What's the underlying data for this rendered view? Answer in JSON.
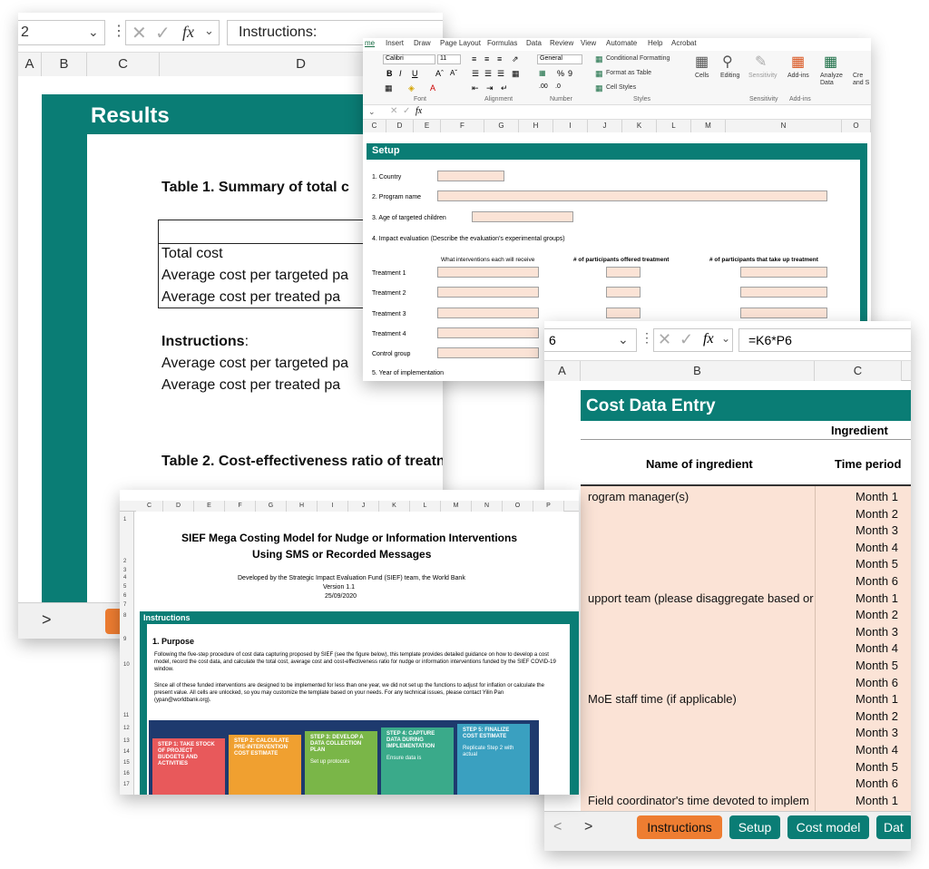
{
  "results_card": {
    "namebox": "2",
    "formula": "Instructions:",
    "fx": "fx",
    "col_headers": [
      "A",
      "B",
      "C",
      "D"
    ],
    "title": "Results",
    "table1_title": "Table 1. Summary of total c",
    "rows": [
      "Total cost",
      "Average cost per targeted pa",
      "Average cost per treated pa"
    ],
    "instructions_label": "Instructions",
    "instructions_colon": ":",
    "instr_rows": [
      "Average cost per targeted pa",
      "Average cost per treated pa"
    ],
    "table2_title": "Table 2. Cost-effectiveness ratio of treatn",
    "nav": ">"
  },
  "setup_card": {
    "menu": [
      "me",
      "Insert",
      "Draw",
      "Page Layout",
      "Formulas",
      "Data",
      "Review",
      "View",
      "Automate",
      "Help",
      "Acrobat"
    ],
    "font_name": "Calibri",
    "font_size": "11",
    "number_format": "General",
    "conditional": "Conditional Formatting",
    "format_table": "Format as Table",
    "cell_styles": "Cell Styles",
    "cells": "Cells",
    "editing": "Editing",
    "sensitivity": "Sensitivity",
    "addins": "Add-ins",
    "analyze": "Analyze\nData",
    "cre": "Cre\nand S",
    "groups": [
      "Font",
      "Alignment",
      "Number",
      "Styles",
      "Sensitivity",
      "Add-ins"
    ],
    "col_headers": [
      "C",
      "D",
      "E",
      "F",
      "G",
      "H",
      "I",
      "J",
      "K",
      "L",
      "M",
      "N",
      "O"
    ],
    "title": "Setup",
    "country": "1. Country",
    "program": "2. Program name",
    "age": "3. Age of targeted children",
    "impact": "4. Impact evaluation (Describe the evaluation's experimental groups)",
    "col1": "What interventions each will receive",
    "col2": "# of participants offered treatment",
    "col3": "# of participants that take up treatment",
    "treatments": [
      "Treatment 1",
      "Treatment 2",
      "Treatment 3",
      "Treatment 4",
      "Control group"
    ],
    "year": "5. Year of implementation"
  },
  "cost_card": {
    "namebox": "6",
    "formula": "=K6*P6",
    "fx": "fx",
    "col_headers": [
      "A",
      "B",
      "C"
    ],
    "title": "Cost Data Entry",
    "ingredient": "Ingredient",
    "name_hdr": "Name of ingredient",
    "time_hdr": "Time period",
    "items": [
      {
        "name": "rogram manager(s)",
        "months": [
          "Month 1",
          "Month 2",
          "Month 3",
          "Month 4",
          "Month 5",
          "Month 6"
        ]
      },
      {
        "name": "upport team (please disaggregate based or",
        "months": [
          "Month 1",
          "Month 2",
          "Month 3",
          "Month 4",
          "Month 5",
          "Month 6"
        ]
      },
      {
        "name": "MoE staff time (if applicable)",
        "months": [
          "Month 1",
          "Month 2",
          "Month 3",
          "Month 4",
          "Month 5",
          "Month 6"
        ]
      },
      {
        "name": "Field coordinator's time devoted to implem",
        "months": [
          "Month 1"
        ]
      }
    ],
    "tabs": [
      "Instructions",
      "Setup",
      "Cost model",
      "Dat"
    ],
    "nav_left": "<",
    "nav_right": ">"
  },
  "instr_card": {
    "col_headers": [
      "C",
      "D",
      "E",
      "F",
      "G",
      "H",
      "I",
      "J",
      "K",
      "L",
      "M",
      "N",
      "O",
      "P"
    ],
    "row_nums": [
      "1",
      "2",
      "3",
      "4",
      "5",
      "6",
      "7",
      "8",
      "9",
      "10",
      "11",
      "12",
      "13",
      "14",
      "15",
      "16",
      "17"
    ],
    "title_line1": "SIEF Mega Costing Model for Nudge or Information Interventions",
    "title_line2": "Using SMS or Recorded Messages",
    "developed": "Developed by the Strategic Impact Evaluation Fund (SIEF) team, the World Bank",
    "version": "Version 1.1",
    "date": "25/09/2020",
    "section": "Instructions",
    "purpose": "1. Purpose",
    "para1": "Following the five-step procedure of cost data capturing proposed by SIEF (see the figure below), this template provides detailed guidance on how to develop a cost model, record the cost data, and calculate the total cost, average cost and cost-effectiveness ratio for nudge or information interventions funded by the SIEF COVID-19 window.",
    "para2": "Since all of these funded interventions are designed to be implemented for less than one year, we did not set up the functions to adjust for inflation or calculate the present value. All cells are unlocked, so you may customize the template based on your needs. For any technical issues, please contact Yilin Pan (ypan@worldbank.org).",
    "steps": [
      {
        "title": "STEP 1: TAKE STOCK OF PROJECT BUDGETS AND ACTIVITIES",
        "color": "#e8595b"
      },
      {
        "title": "STEP 2: CALCULATE PRE-INTERVENTION COST ESTIMATE",
        "color": "#f0a030"
      },
      {
        "title": "STEP 3: DEVELOP A DATA COLLECTION PLAN",
        "color": "#7ab648",
        "sub": "Set up protocols"
      },
      {
        "title": "STEP 4: CAPTURE DATA DURING IMPLEMENTATION",
        "color": "#3aaa8a",
        "sub": "Ensure data is"
      },
      {
        "title": "STEP 5: FINALIZE COST ESTIMATE",
        "color": "#3aa0c0",
        "sub": "Replicate Step 2 with actual"
      }
    ]
  },
  "colors": {
    "teal": "#0a7d75",
    "pink": "#fbe3d6",
    "orange_tab": "#ee7d31",
    "teal_tab": "#0a7d75"
  }
}
